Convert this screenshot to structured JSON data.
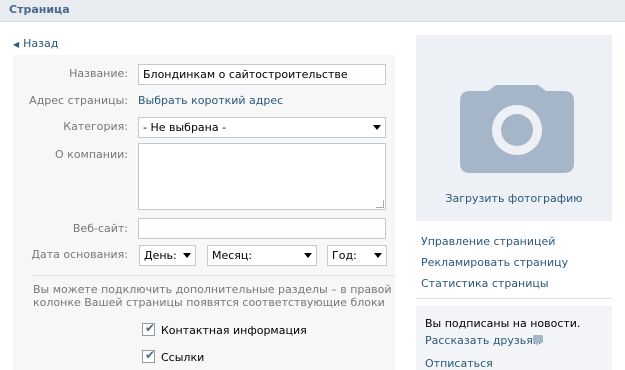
{
  "header": {
    "title": "Страница"
  },
  "nav": {
    "back": "Назад"
  },
  "form": {
    "name_label": "Название:",
    "name_value": "Блондинкам о сайтостроительстве",
    "address_label": "Адрес страницы:",
    "address_link": "Выбрать короткий адрес",
    "category_label": "Категория:",
    "category_value": "- Не выбрана -",
    "about_label": "О компании:",
    "about_value": "",
    "website_label": "Веб-сайт:",
    "website_value": "",
    "founded_label": "Дата основания:",
    "day_value": "День:",
    "month_value": "Месяц:",
    "year_value": "Год:",
    "sections_hint": "Вы можете подключить дополнительные разделы – в правой колонке Вашей страницы появятся соответствующие блоки",
    "checkboxes": [
      {
        "label": "Контактная информация",
        "checked": true
      },
      {
        "label": "Ссылки",
        "checked": true
      }
    ]
  },
  "sidebar": {
    "upload_photo": "Загрузить фотографию",
    "links": [
      "Управление страницей",
      "Рекламировать страницу",
      "Статистика страницы"
    ],
    "subscription": {
      "status": "Вы подписаны на новости.",
      "tell_friends": "Рассказать друзьям",
      "unsubscribe": "Отписаться"
    }
  },
  "colors": {
    "link": "#2b587a",
    "header_bg": "#e8ecf1",
    "form_bg": "#f7f7f7",
    "photo_bg": "#edf1f5",
    "camera": "#a5b6c9"
  }
}
